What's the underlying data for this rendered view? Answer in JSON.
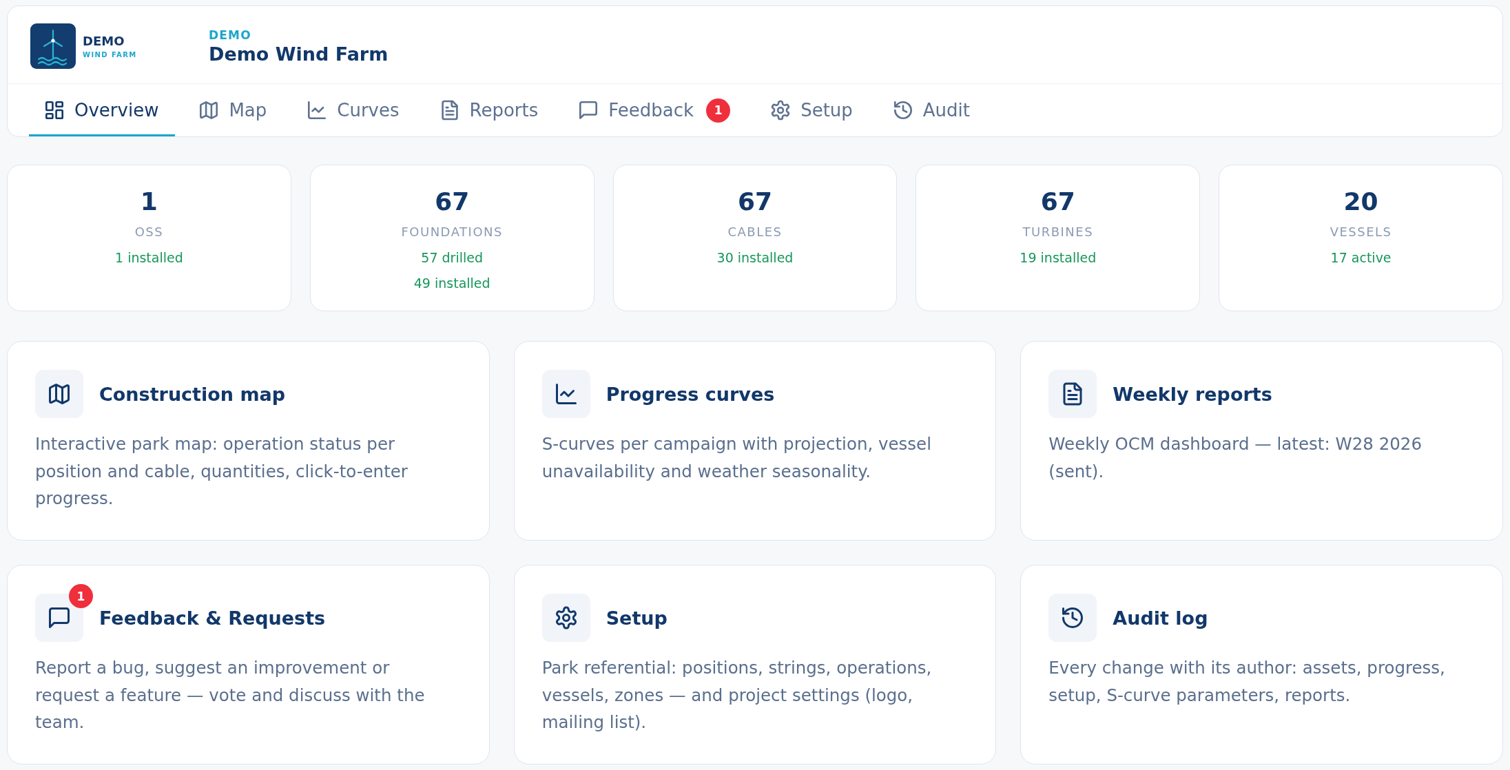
{
  "brand": {
    "name": "DEMO",
    "tagline": "WIND FARM"
  },
  "project": {
    "label": "DEMO",
    "title": "Demo Wind Farm"
  },
  "tabs": [
    {
      "kind": "overview",
      "label": "Overview",
      "selected": true
    },
    {
      "kind": "map",
      "label": "Map",
      "selected": false
    },
    {
      "kind": "curves",
      "label": "Curves",
      "selected": false
    },
    {
      "kind": "reports",
      "label": "Reports",
      "selected": false
    },
    {
      "kind": "feedback",
      "label": "Feedback",
      "badge": "1",
      "selected": false
    },
    {
      "kind": "setup",
      "label": "Setup",
      "selected": false
    },
    {
      "kind": "audit",
      "label": "Audit",
      "selected": false
    }
  ],
  "stats": [
    {
      "value": "1",
      "label": "OSS",
      "details": [
        "1 installed"
      ]
    },
    {
      "value": "67",
      "label": "FOUNDATIONS",
      "details": [
        "57 drilled",
        "49 installed"
      ]
    },
    {
      "value": "67",
      "label": "CABLES",
      "details": [
        "30 installed"
      ]
    },
    {
      "value": "67",
      "label": "TURBINES",
      "details": [
        "19 installed"
      ]
    },
    {
      "value": "20",
      "label": "VESSELS",
      "details": [
        "17 active"
      ]
    }
  ],
  "cards": [
    {
      "kind": "map",
      "title": "Construction map",
      "description": "Interactive park map: operation status per position and cable, quantities, click-to-enter progress."
    },
    {
      "kind": "curves",
      "title": "Progress curves",
      "description": "S-curves per campaign with projection, vessel unavailability and weather seasonality."
    },
    {
      "kind": "reports",
      "title": "Weekly reports",
      "description": "Weekly OCM dashboard — latest: W28 2026 (sent)."
    },
    {
      "kind": "feedback",
      "title": "Feedback & Requests",
      "badge": "1",
      "description": "Report a bug, suggest an improvement or request a feature — vote and discuss with the team."
    },
    {
      "kind": "setup",
      "title": "Setup",
      "description": "Park referential: positions, strings, operations, vessels, zones — and project settings (logo, mailing list)."
    },
    {
      "kind": "audit",
      "title": "Audit log",
      "description": "Every change with its author: assets, progress, setup, S-curve parameters, reports."
    }
  ]
}
